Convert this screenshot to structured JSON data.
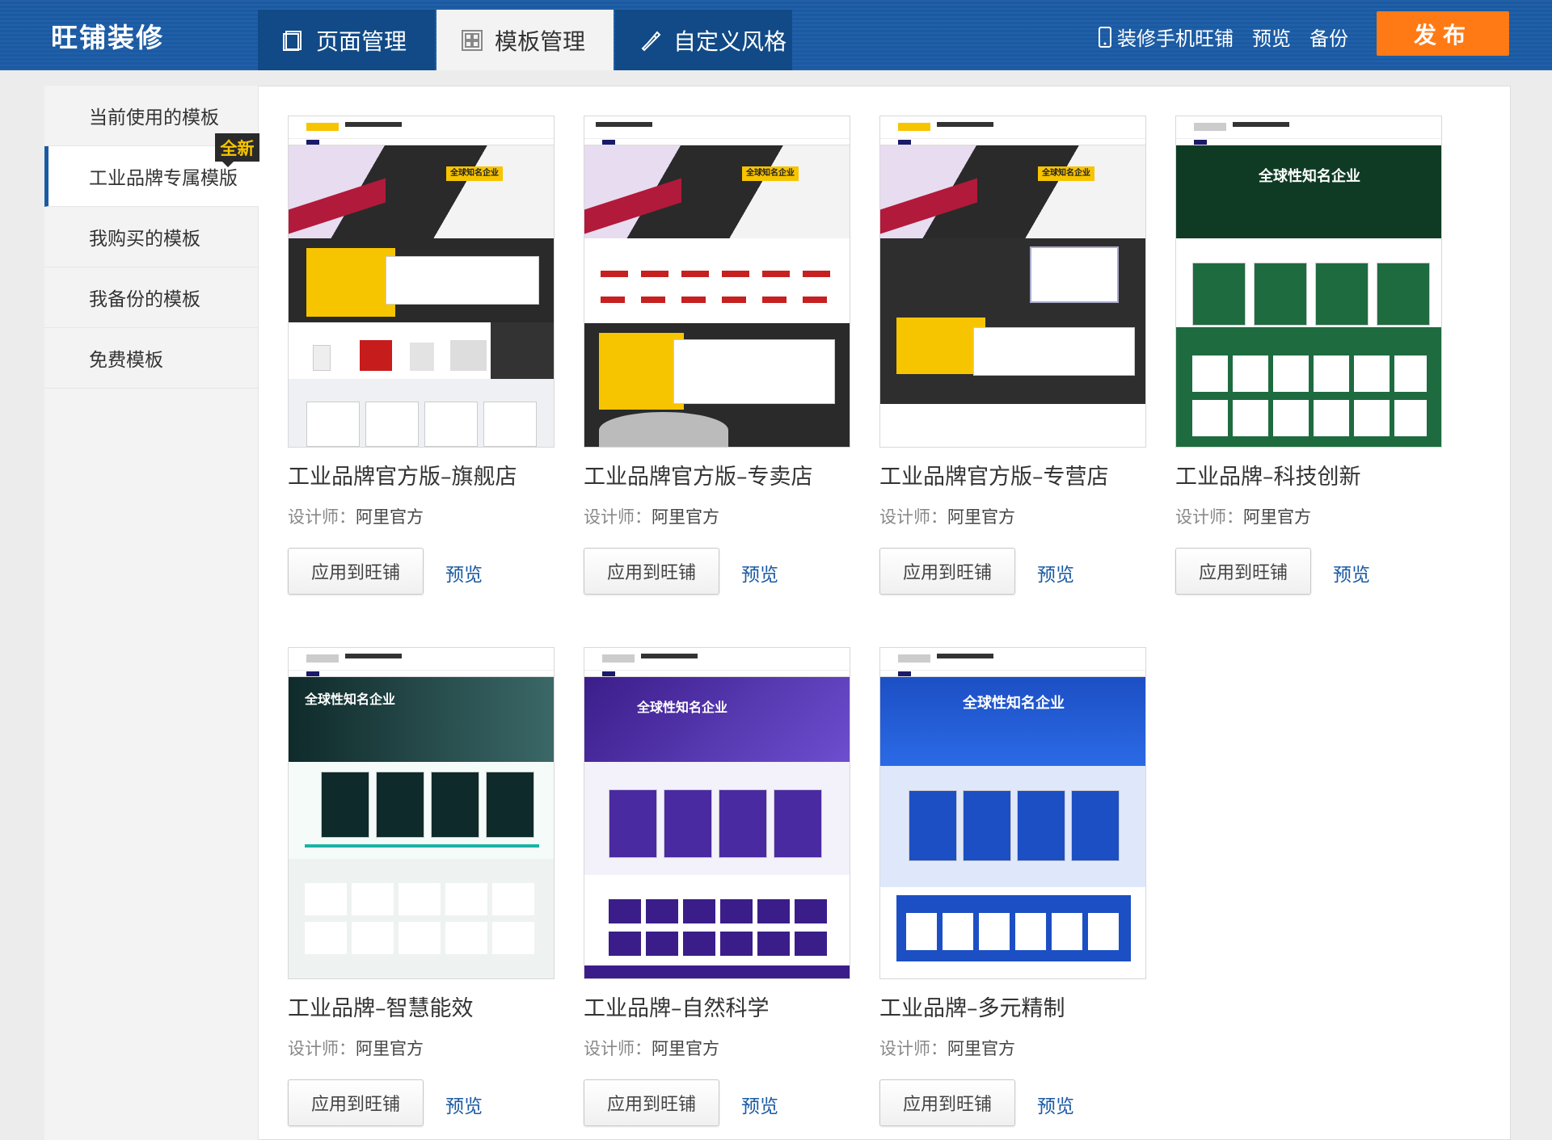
{
  "app": {
    "logo": "旺铺装修"
  },
  "tabs": [
    {
      "label": "页面管理",
      "icon": "page-icon"
    },
    {
      "label": "模板管理",
      "icon": "grid-icon"
    },
    {
      "label": "自定义风格",
      "icon": "brush-icon"
    }
  ],
  "toolbar": {
    "mobile": "装修手机旺铺",
    "preview": "预览",
    "backup": "备份",
    "publish": "发布"
  },
  "sidebar": {
    "items": [
      {
        "label": "当前使用的模板"
      },
      {
        "label": "工业品牌专属模版",
        "badge": "全新"
      },
      {
        "label": "我购买的模板"
      },
      {
        "label": "我备份的模板"
      },
      {
        "label": "免费模板"
      }
    ]
  },
  "card_common": {
    "designer_label": "设计师：",
    "apply_label": "应用到旺铺",
    "preview_label": "预览"
  },
  "templates": [
    {
      "title": "工业品牌官方版–旗舰店",
      "designer": "阿里官方",
      "theme": "#f7c400"
    },
    {
      "title": "工业品牌官方版–专卖店",
      "designer": "阿里官方",
      "theme": "#f7c400"
    },
    {
      "title": "工业品牌官方版–专营店",
      "designer": "阿里官方",
      "theme": "#f7c400"
    },
    {
      "title": "工业品牌–科技创新",
      "designer": "阿里官方",
      "theme": "#1b5e3a"
    },
    {
      "title": "工业品牌–智慧能效",
      "designer": "阿里官方",
      "theme": "#1a3b3b"
    },
    {
      "title": "工业品牌–自然科学",
      "designer": "阿里官方",
      "theme": "#4a2aa0"
    },
    {
      "title": "工业品牌–多元精制",
      "designer": "阿里官方",
      "theme": "#1c4fc4"
    }
  ],
  "thumb_text": {
    "hero_1": "全球知名企业",
    "hero_2": "全球性知名企业"
  },
  "colors": {
    "brand": "#1a5aa3",
    "publish": "#ff7a14",
    "badge_text": "#f7c400"
  }
}
